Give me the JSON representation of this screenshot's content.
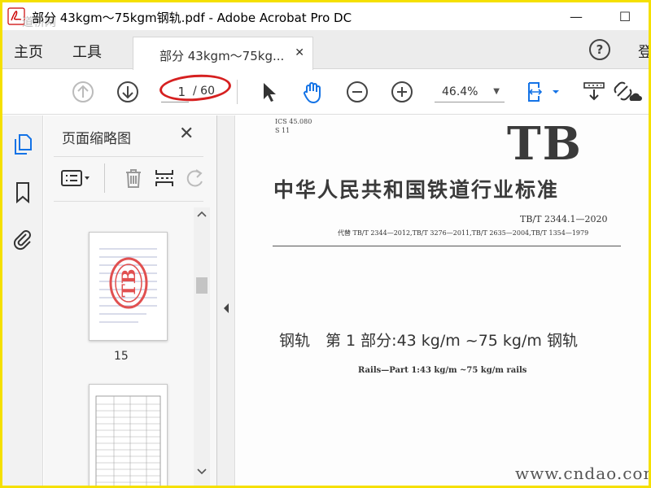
{
  "window": {
    "title": "部分 43kgm～75kgm钢轨.pdf - Adobe Acrobat Pro DC",
    "watermark": "道桥网",
    "minimize_label": "—",
    "maximize_label": "☐"
  },
  "tabs": {
    "home": "主页",
    "tools": "工具",
    "document_tab": "部分 43kgm～75kg...",
    "close_tab": "✕",
    "help": "?",
    "sign_in": "登"
  },
  "toolbar": {
    "current_page": "1",
    "total_pages": "/ 60",
    "zoom": "46.4%",
    "zoom_caret": "▼",
    "annotation_color": "#d62020"
  },
  "sidebar": {
    "panel_title": "页面缩略图",
    "panel_close": "✕",
    "thumbnail_page_label": "15"
  },
  "document": {
    "ics": "ICS 45.080",
    "s_code": "S 11",
    "logo": "TB",
    "standard_title": "中华人民共和国铁道行业标准",
    "standard_number": "TB/T 2344.1—2020",
    "replaces": "代替 TB/T 2344—2012,TB/T 3276—2011,TB/T 2635—2004,TB/T 1354—1979",
    "cn_title": "钢轨　第 1 部分:43 kg/m ~75 kg/m 钢轨",
    "en_title": "Rails—Part 1:43 kg/m ~75 kg/m rails",
    "site_watermark": "www.cndao.com"
  },
  "colors": {
    "frame_border": "#f5e000",
    "accent_blue": "#1473e6"
  }
}
